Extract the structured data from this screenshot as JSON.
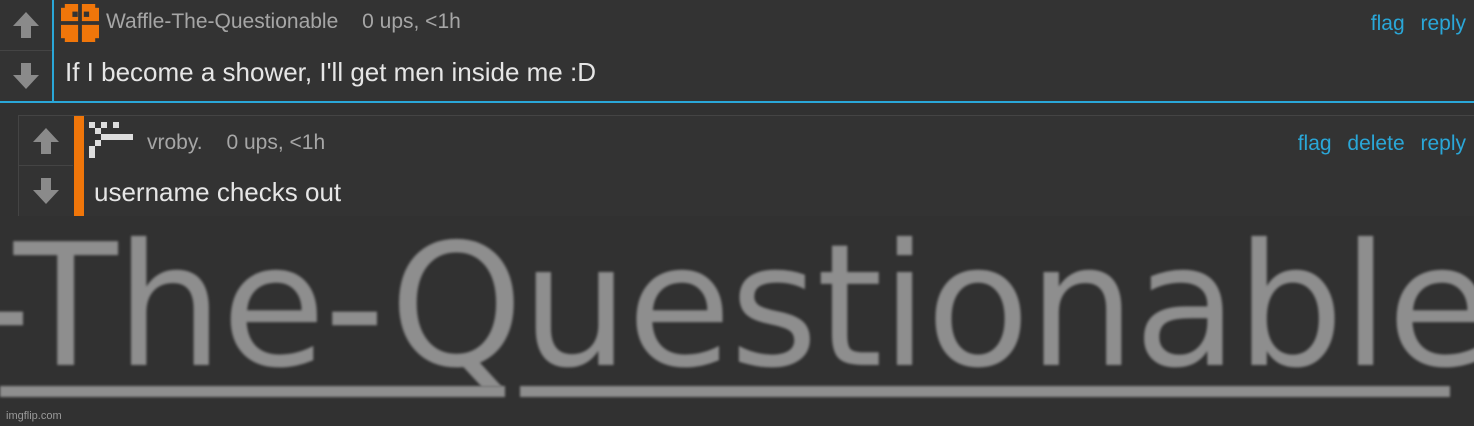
{
  "comments": [
    {
      "username": "Waffle-The-Questionable",
      "stats": "0 ups, <1h",
      "text": "If I become a shower, I'll get men inside me :D",
      "actions": [
        "flag",
        "reply"
      ],
      "avatar_icon": "orange-pixel-avatar-icon",
      "colors": {
        "avatar": "#f0760a",
        "accent": "#2aa7d8"
      }
    },
    {
      "username": "vroby.",
      "stats": "0 ups, <1h",
      "text": "username checks out",
      "actions": [
        "flag",
        "delete",
        "reply"
      ],
      "avatar_icon": "white-pixel-avatar-icon",
      "colors": {
        "avatar": "#dddddd",
        "bar": "#f0760a"
      }
    }
  ],
  "vote_icons": {
    "up": "arrow-up-icon",
    "down": "arrow-down-icon"
  },
  "zoom_caption": "-The-Questionable",
  "watermark": "imgflip.com"
}
